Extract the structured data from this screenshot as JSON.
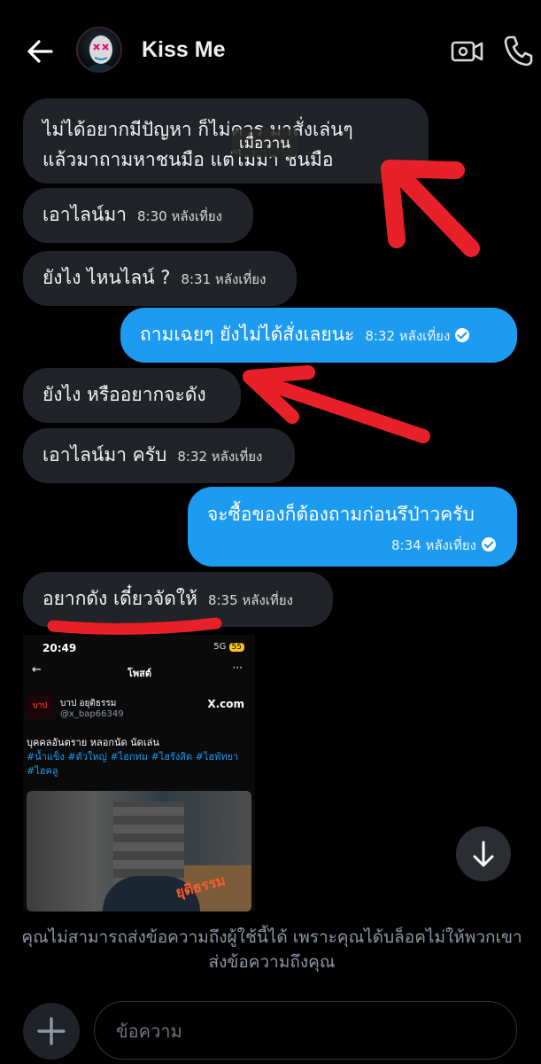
{
  "header": {
    "contact_name": "Kiss Me"
  },
  "tooltip": "เมื่อวาน",
  "messages": [
    {
      "dir": "in",
      "text_line1": "ไม่ได้อยากมีปัญหา ก็ไม่ควร มาสั่งเล่นๆ",
      "text_line2": "แล้วมาถามหาชนมือ แต่ไม่มา ชนมือ"
    },
    {
      "dir": "in",
      "text": "เอาไลน์มา",
      "time": "8:30 หลังเที่ยง"
    },
    {
      "dir": "in",
      "text": "ยังไง ไหนไลน์ ?",
      "time": "8:31 หลังเที่ยง"
    },
    {
      "dir": "out",
      "text": "ถามเฉยๆ ยังไม่ได้สั่งเลยนะ",
      "time": "8:32 หลังเที่ยง"
    },
    {
      "dir": "in",
      "text": "ยังไง หรืออยากจะดัง"
    },
    {
      "dir": "in",
      "text": "เอาไลน์มา ครับ",
      "time": "8:32 หลังเที่ยง"
    },
    {
      "dir": "out",
      "text": "จะซื้อของก็ต้องถามก่อนรึป่าวครับ",
      "time": "8:34 หลังเที่ยง"
    },
    {
      "dir": "in",
      "text": "อยากดัง เดี๋ยวจัดให้",
      "time": "8:35 หลังเที่ยง"
    }
  ],
  "embedded_post": {
    "status_time": "20:49",
    "status_network": "5G",
    "status_battery": "55",
    "title": "โพสต์",
    "logo_text": "บาป",
    "name": "บาป อยุติธรรม",
    "handle": "@x_bap66349",
    "source": "X.com",
    "body": "บุคคลอันตราย หลอกนัด นัดเล่น",
    "tags": "#น้ำแข็ง #ตัวใหญ่ #ไฮกทม #ไฮรังสิต #ไฮพัทยา #ไฮคลู",
    "stamp": "ยุติธรรม"
  },
  "blocked_notice": "คุณไม่สามารถส่งข้อความถึงผู้ใช้นี้ได้ เพราะคุณได้บล็อคไม่ให้พวกเขาส่งข้อความถึงคุณ",
  "composer": {
    "placeholder": "ข้อความ"
  },
  "colors": {
    "outgoing_bubble": "#1d9bf0",
    "incoming_bubble": "#202327",
    "annotation_red": "#e8202a"
  }
}
